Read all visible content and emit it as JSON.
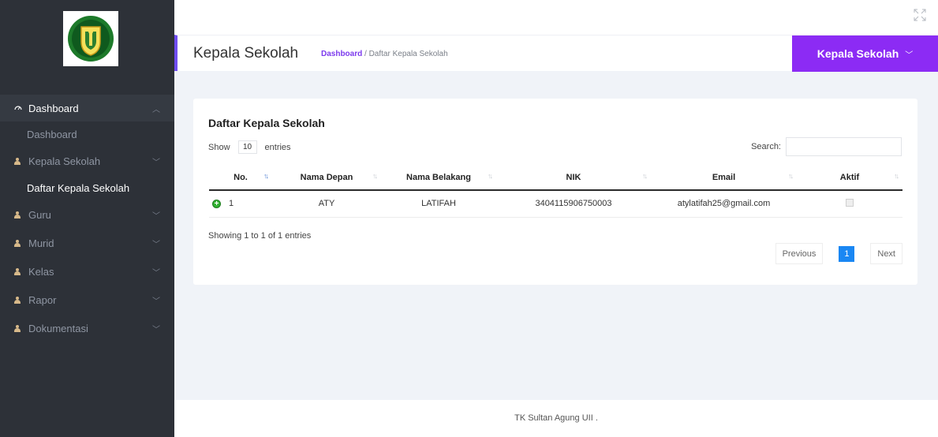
{
  "sidebar": {
    "logo_alt": "school-logo",
    "items": [
      {
        "label": "Dashboard",
        "icon": "dashboard-icon",
        "chevron": "^",
        "active": true
      },
      {
        "label": "Kepala Sekolah",
        "icon": "user-icon",
        "chevron": "v"
      },
      {
        "label": "Guru",
        "icon": "user-icon",
        "chevron": "v"
      },
      {
        "label": "Murid",
        "icon": "user-icon",
        "chevron": "v"
      },
      {
        "label": "Kelas",
        "icon": "user-icon",
        "chevron": "v"
      },
      {
        "label": "Rapor",
        "icon": "user-icon",
        "chevron": "v"
      },
      {
        "label": "Dokumentasi",
        "icon": "user-icon",
        "chevron": "v"
      }
    ],
    "sub_dashboard": "Dashboard",
    "sub_kepala": "Daftar Kepala Sekolah"
  },
  "header": {
    "title": "Kepala Sekolah",
    "breadcrumb_link": "Dashboard",
    "breadcrumb_sep": "/",
    "breadcrumb_current": "Daftar Kepala Sekolah",
    "role_label": "Kepala Sekolah",
    "accent": "#8c2bf4"
  },
  "card": {
    "title": "Daftar Kepala Sekolah",
    "show_label": "Show",
    "entries_value": "10",
    "entries_label": "entries",
    "search_label": "Search:",
    "columns": [
      "No.",
      "Nama Depan",
      "Nama Belakang",
      "NIK",
      "Email",
      "Aktif"
    ],
    "rows": [
      {
        "no": "1",
        "nama_depan": "ATY",
        "nama_belakang": "LATIFAH",
        "nik": "3404115906750003",
        "email": "atylatifah25@gmail.com",
        "aktif": true
      }
    ],
    "info": "Showing 1 to 1 of 1 entries",
    "prev_label": "Previous",
    "page": "1",
    "next_label": "Next"
  },
  "footer": {
    "text": "TK Sultan Agung UII ."
  }
}
